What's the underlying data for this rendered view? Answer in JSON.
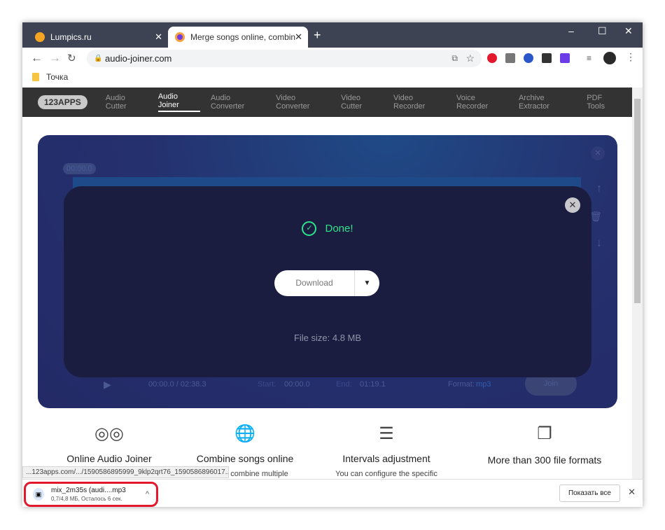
{
  "tabs": [
    {
      "title": "Lumpics.ru",
      "favicon_color": "#f4a523"
    },
    {
      "title": "Merge songs online, combine mp",
      "favicon_color": "#6a3de8",
      "active": true
    }
  ],
  "url": "audio-joiner.com",
  "bookmarks": [
    {
      "label": "Точка"
    }
  ],
  "site": {
    "logo": "123APPS",
    "nav": [
      "Audio Cutter",
      "Audio Joiner",
      "Audio Converter",
      "Video Converter",
      "Video Cutter",
      "Video Recorder",
      "Voice Recorder",
      "Archive Extractor",
      "PDF Tools"
    ],
    "active": "Audio Joiner"
  },
  "player": {
    "time_marker": "00:00.0",
    "time": "00:00.0 / 02:38.3",
    "start_label": "Start:",
    "start": "00:00.0",
    "end_label": "End:",
    "end": "01:19.1",
    "format_label": "Format:",
    "format": "mp3",
    "join": "Join"
  },
  "modal": {
    "status": "Done!",
    "download": "Download",
    "file_size": "File size: 4.8 MB",
    "accent": "#2de38c"
  },
  "features": [
    {
      "icon": "vinyl-records",
      "title": "Online Audio Joiner"
    },
    {
      "icon": "globe",
      "title": "Combine songs online",
      "desc": "…o can combine multiple"
    },
    {
      "icon": "sliders",
      "title": "Intervals adjustment",
      "desc": "You can configure the specific"
    },
    {
      "icon": "files",
      "title": "More than 300 file formats"
    }
  ],
  "status_url": "...123apps.com/.../1590586895999_9klp2qrt76_1590586896017...",
  "download": {
    "name": "mix_2m35s (audi....mp3",
    "progress": "0,7/4,8 МБ, Осталось 6 сек.",
    "show_all": "Показать все"
  }
}
